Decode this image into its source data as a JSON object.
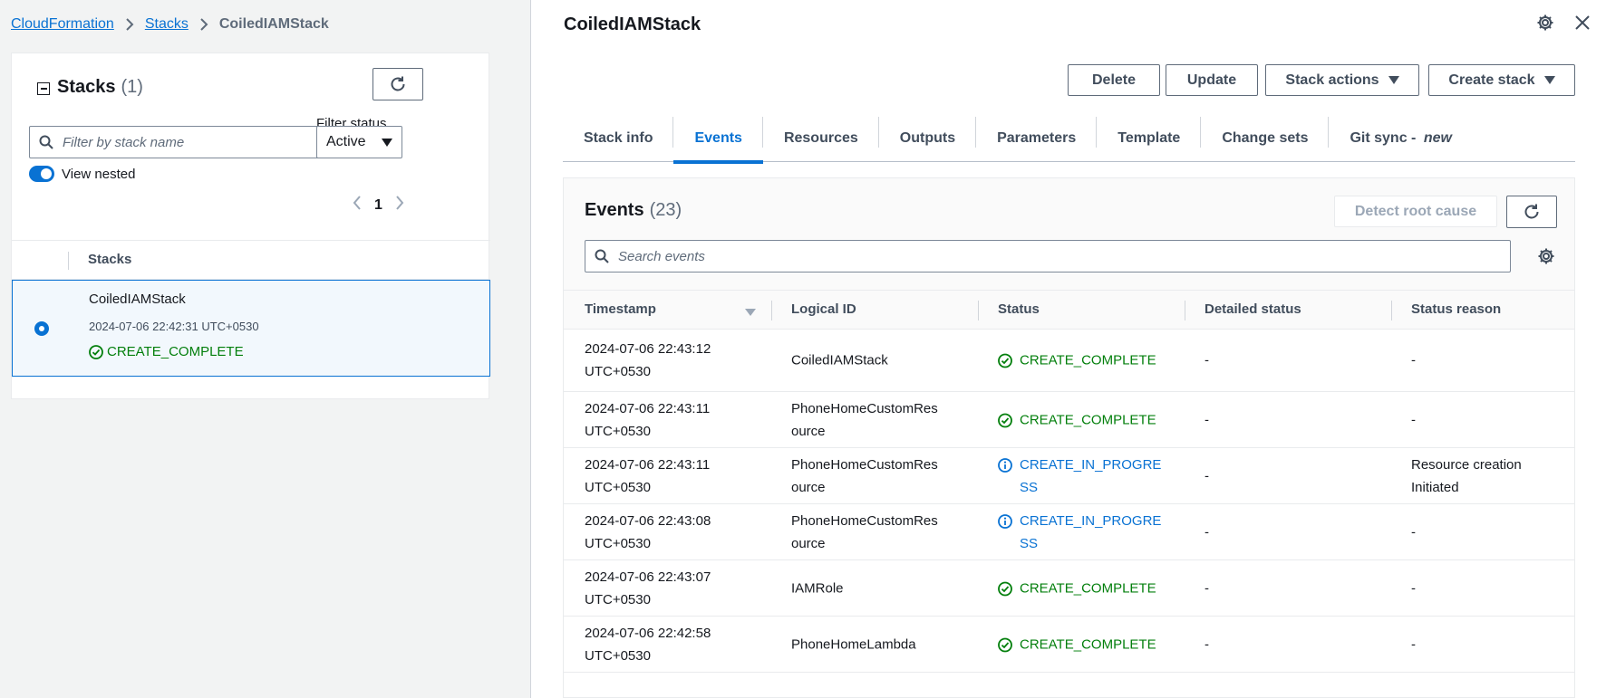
{
  "breadcrumb": {
    "items": [
      "CloudFormation",
      "Stacks"
    ],
    "current": "CoiledIAMStack"
  },
  "stacks_panel": {
    "title": "Stacks",
    "count": "(1)",
    "filter_status_label": "Filter status",
    "search_placeholder": "Filter by stack name",
    "filter_value": "Active",
    "view_nested_label": "View nested",
    "view_nested_on": true,
    "page": "1",
    "column_header": "Stacks",
    "rows": [
      {
        "name": "CoiledIAMStack",
        "timestamp": "2024-07-06 22:42:31 UTC+0530",
        "status": "CREATE_COMPLETE",
        "selected": true
      }
    ]
  },
  "detail": {
    "title": "CoiledIAMStack",
    "buttons": {
      "delete": "Delete",
      "update": "Update",
      "stack_actions": "Stack actions",
      "create_stack": "Create stack"
    },
    "tabs": [
      {
        "label": "Stack info",
        "active": false
      },
      {
        "label": "Events",
        "active": true
      },
      {
        "label": "Resources",
        "active": false
      },
      {
        "label": "Outputs",
        "active": false
      },
      {
        "label": "Parameters",
        "active": false
      },
      {
        "label": "Template",
        "active": false
      },
      {
        "label": "Change sets",
        "active": false
      },
      {
        "label": "Git sync - ",
        "suffix": "new",
        "active": false
      }
    ],
    "events": {
      "title": "Events",
      "count": "(23)",
      "detect_button": "Detect root cause",
      "search_placeholder": "Search events",
      "columns": [
        "Timestamp",
        "Logical ID",
        "Status",
        "Detailed status",
        "Status reason"
      ],
      "rows": [
        {
          "ts1": "2024-07-06 22:43:12",
          "ts2": "UTC+0530",
          "logical_id": "CoiledIAMStack",
          "status": "CREATE_COMPLETE",
          "status_type": "complete",
          "detailed": "-",
          "reason": "-"
        },
        {
          "ts1": "2024-07-06 22:43:11",
          "ts2": "UTC+0530",
          "logical_id": "PhoneHomeCustomResource",
          "status": "CREATE_COMPLETE",
          "status_type": "complete",
          "detailed": "-",
          "reason": "-"
        },
        {
          "ts1": "2024-07-06 22:43:11",
          "ts2": "UTC+0530",
          "logical_id": "PhoneHomeCustomResource",
          "status": "CREATE_IN_PROGRESS",
          "status_type": "progress",
          "detailed": "-",
          "reason": "Resource creation Initiated"
        },
        {
          "ts1": "2024-07-06 22:43:08",
          "ts2": "UTC+0530",
          "logical_id": "PhoneHomeCustomResource",
          "status": "CREATE_IN_PROGRESS",
          "status_type": "progress",
          "detailed": "-",
          "reason": "-"
        },
        {
          "ts1": "2024-07-06 22:43:07",
          "ts2": "UTC+0530",
          "logical_id": "IAMRole",
          "status": "CREATE_COMPLETE",
          "status_type": "complete",
          "detailed": "-",
          "reason": "-"
        },
        {
          "ts1": "2024-07-06 22:42:58",
          "ts2": "UTC+0530",
          "logical_id": "PhoneHomeLambda",
          "status": "CREATE_COMPLETE",
          "status_type": "complete",
          "detailed": "-",
          "reason": "-"
        }
      ]
    }
  },
  "colors": {
    "link": "#0972d3",
    "success": "#037f0c",
    "info": "#0972d3",
    "text": "#16191f",
    "muted": "#5f6b7a"
  },
  "icons": {
    "refresh": "refresh-icon",
    "search": "search-icon",
    "settings": "gear-icon",
    "close": "close-icon",
    "success": "status-success-icon",
    "info": "status-info-icon"
  }
}
